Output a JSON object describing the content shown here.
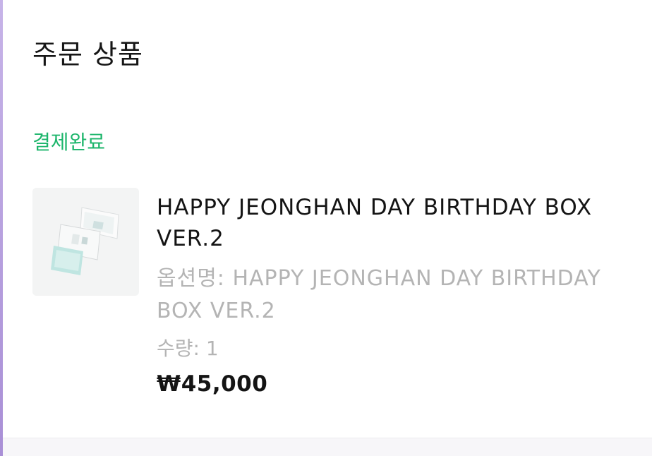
{
  "order": {
    "section_title": "주문 상품",
    "status": "결제완료",
    "item": {
      "image_icon": "product-thumbnail",
      "name": "HAPPY JEONGHAN DAY BIRTHDAY BOX VER.2",
      "option_label": "옵션명: HAPPY JEONGHAN DAY BIRTHDAY BOX VER.2",
      "quantity_label": "수량: 1",
      "price": "₩45,000"
    }
  },
  "colors": {
    "status_green": "#1cb56b",
    "muted_text": "#b4b4b4",
    "accent_left": "#a98fd6"
  }
}
